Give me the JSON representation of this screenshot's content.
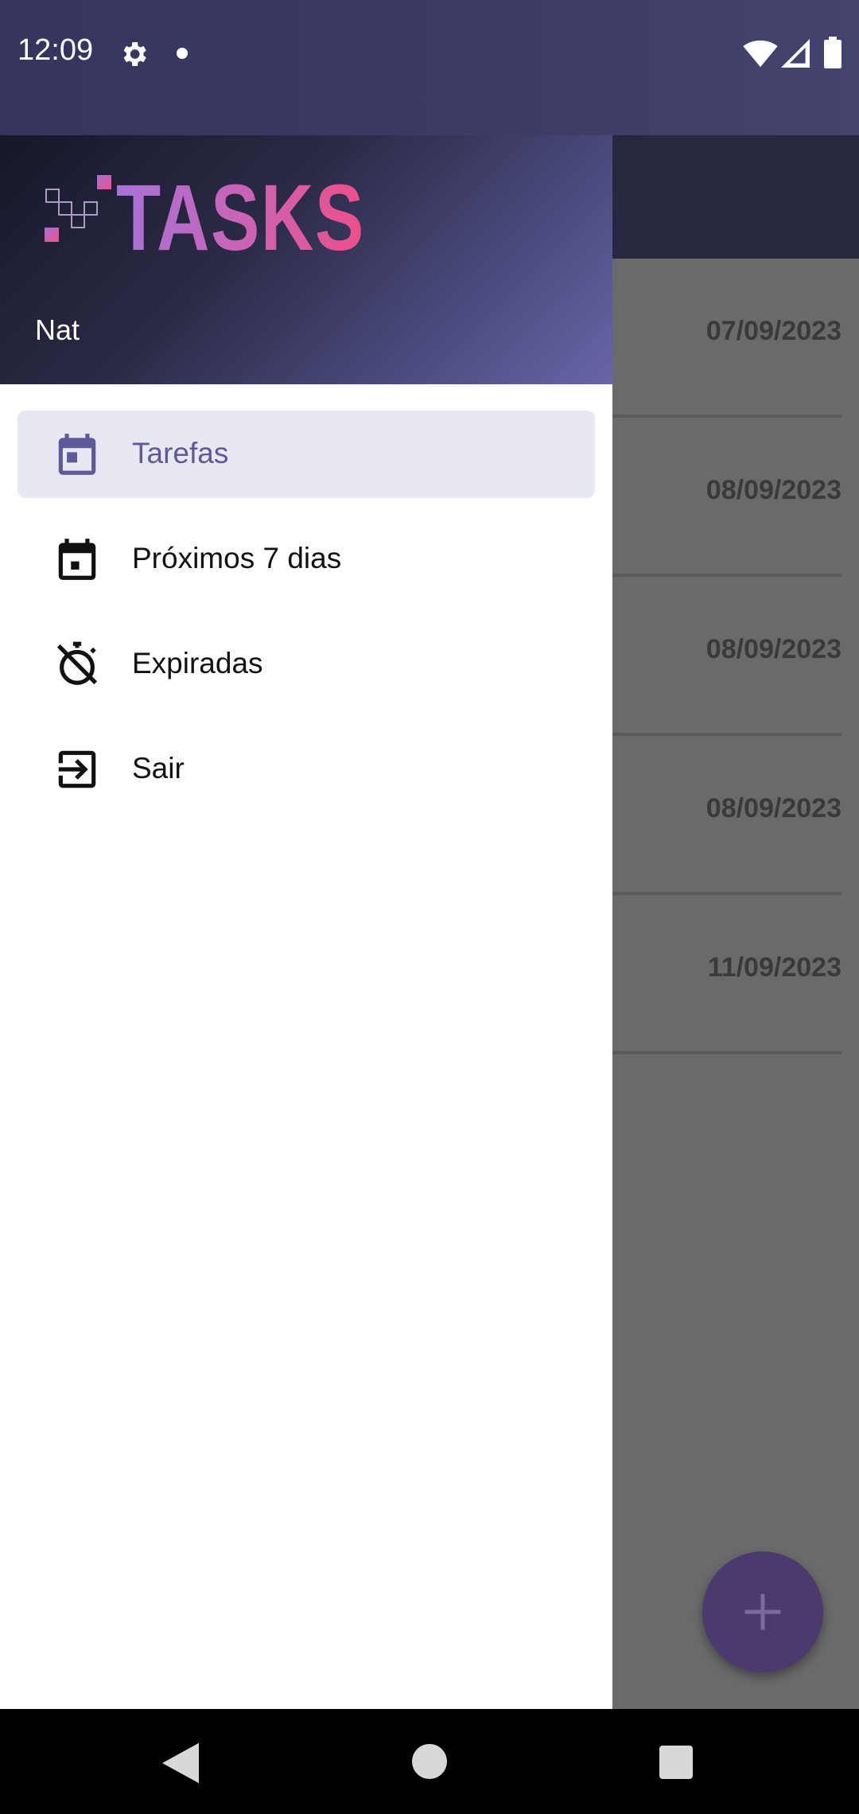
{
  "status_bar": {
    "time": "12:09"
  },
  "app": {
    "logo_text": "TASKS",
    "user_name": "Nat",
    "background_dates": [
      "07/09/2023",
      "08/09/2023",
      "08/09/2023",
      "08/09/2023",
      "11/09/2023"
    ]
  },
  "drawer": {
    "items": [
      {
        "label": "Tarefas",
        "icon": "calendar-today-icon",
        "active": true
      },
      {
        "label": "Próximos 7 dias",
        "icon": "calendar-week-icon",
        "active": false
      },
      {
        "label": "Expiradas",
        "icon": "timer-off-icon",
        "active": false
      },
      {
        "label": "Sair",
        "icon": "logout-icon",
        "active": false
      }
    ]
  },
  "colors": {
    "accent": "#5e5a9a",
    "active_bg": "#e8e8f2",
    "fab": "#4a3a6e",
    "header_dark": "#17172a",
    "header_light": "#6666a8"
  }
}
